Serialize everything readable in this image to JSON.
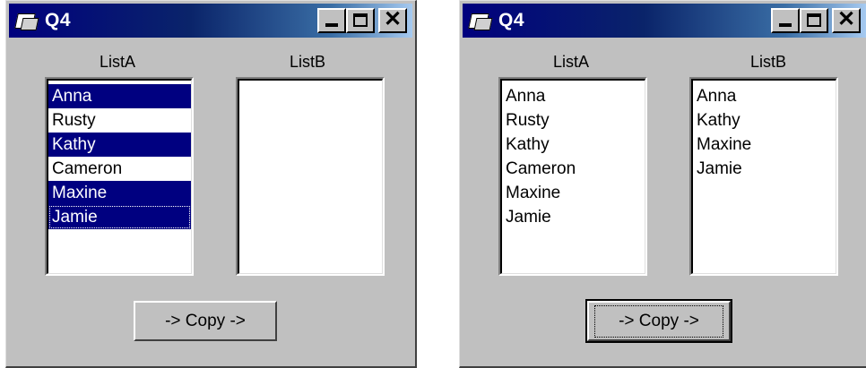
{
  "windows": [
    {
      "title": "Q4",
      "list_a": {
        "label": "ListA",
        "items": [
          {
            "text": "Anna",
            "selected": true
          },
          {
            "text": "Rusty",
            "selected": false
          },
          {
            "text": "Kathy",
            "selected": true
          },
          {
            "text": "Cameron",
            "selected": false
          },
          {
            "text": "Maxine",
            "selected": true
          },
          {
            "text": "Jamie",
            "selected": true
          }
        ]
      },
      "list_b": {
        "label": "ListB",
        "items": []
      },
      "copy_button": {
        "label": "-> Copy ->"
      }
    },
    {
      "title": "Q4",
      "list_a": {
        "label": "ListA",
        "items": [
          {
            "text": "Anna",
            "selected": false
          },
          {
            "text": "Rusty",
            "selected": false
          },
          {
            "text": "Kathy",
            "selected": false
          },
          {
            "text": "Cameron",
            "selected": false
          },
          {
            "text": "Maxine",
            "selected": false
          },
          {
            "text": "Jamie",
            "selected": false
          }
        ]
      },
      "list_b": {
        "label": "ListB",
        "items": [
          {
            "text": "Anna",
            "selected": false
          },
          {
            "text": "Kathy",
            "selected": false
          },
          {
            "text": "Maxine",
            "selected": false
          },
          {
            "text": "Jamie",
            "selected": false
          }
        ]
      },
      "copy_button": {
        "label": "-> Copy ->"
      }
    }
  ],
  "icons": {
    "app": "form-icon",
    "minimize": "minimize-icon",
    "maximize": "maximize-icon",
    "close": "close-icon"
  },
  "colors": {
    "title_bar_start": "#00007e",
    "title_bar_end": "#a6caf0",
    "selection": "#000080",
    "face": "#c0c0c0"
  }
}
